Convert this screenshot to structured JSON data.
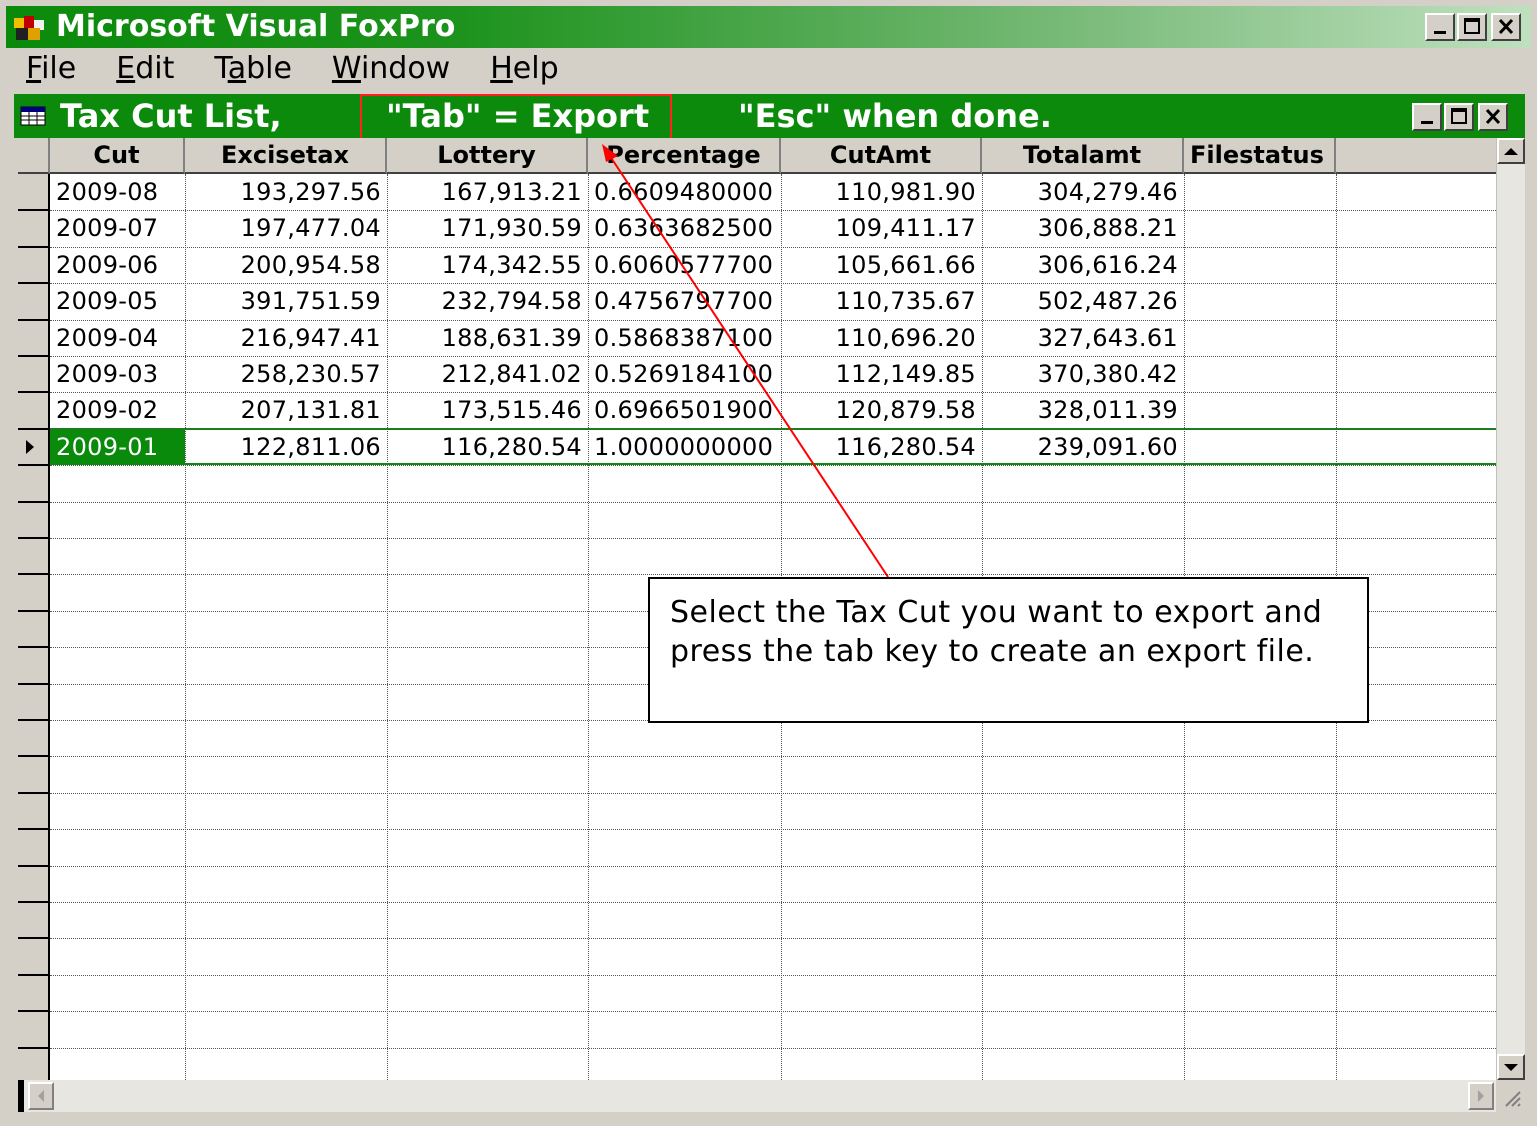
{
  "app": {
    "title": "Microsoft Visual FoxPro"
  },
  "menu": {
    "items": [
      {
        "pre": "",
        "ul": "F",
        "post": "ile"
      },
      {
        "pre": "",
        "ul": "E",
        "post": "dit"
      },
      {
        "pre": "T",
        "ul": "a",
        "post": "ble"
      },
      {
        "pre": "",
        "ul": "W",
        "post": "indow"
      },
      {
        "pre": "",
        "ul": "H",
        "post": "elp"
      }
    ]
  },
  "window": {
    "title_part1": "Tax Cut List,",
    "title_part2": "\"Tab\" = Export",
    "title_part3": "\"Esc\" when done."
  },
  "table": {
    "columns": [
      "Cut",
      "Excisetax",
      "Lottery",
      "Percentage",
      "CutAmt",
      "Totalamt",
      "Filestatus"
    ],
    "rows": [
      [
        "2009-08",
        "193,297.56",
        "167,913.21",
        "0.6609480000",
        "110,981.90",
        "304,279.46",
        ""
      ],
      [
        "2009-07",
        "197,477.04",
        "171,930.59",
        "0.6363682500",
        "109,411.17",
        "306,888.21",
        ""
      ],
      [
        "2009-06",
        "200,954.58",
        "174,342.55",
        "0.6060577700",
        "105,661.66",
        "306,616.24",
        ""
      ],
      [
        "2009-05",
        "391,751.59",
        "232,794.58",
        "0.4756797700",
        "110,735.67",
        "502,487.26",
        ""
      ],
      [
        "2009-04",
        "216,947.41",
        "188,631.39",
        "0.5868387100",
        "110,696.20",
        "327,643.61",
        ""
      ],
      [
        "2009-03",
        "258,230.57",
        "212,841.02",
        "0.5269184100",
        "112,149.85",
        "370,380.42",
        ""
      ],
      [
        "2009-02",
        "207,131.81",
        "173,515.46",
        "0.6966501900",
        "120,879.58",
        "328,011.39",
        ""
      ],
      [
        "2009-01",
        "122,811.06",
        "116,280.54",
        "1.0000000000",
        "116,280.54",
        "239,091.60",
        ""
      ]
    ],
    "current_row": 7
  },
  "annotation": {
    "text": "Select the Tax Cut you want to export and press the tab key to create an export file."
  },
  "colors": {
    "titlebar": "#0a8a0a",
    "highlight": "#ff2020"
  }
}
